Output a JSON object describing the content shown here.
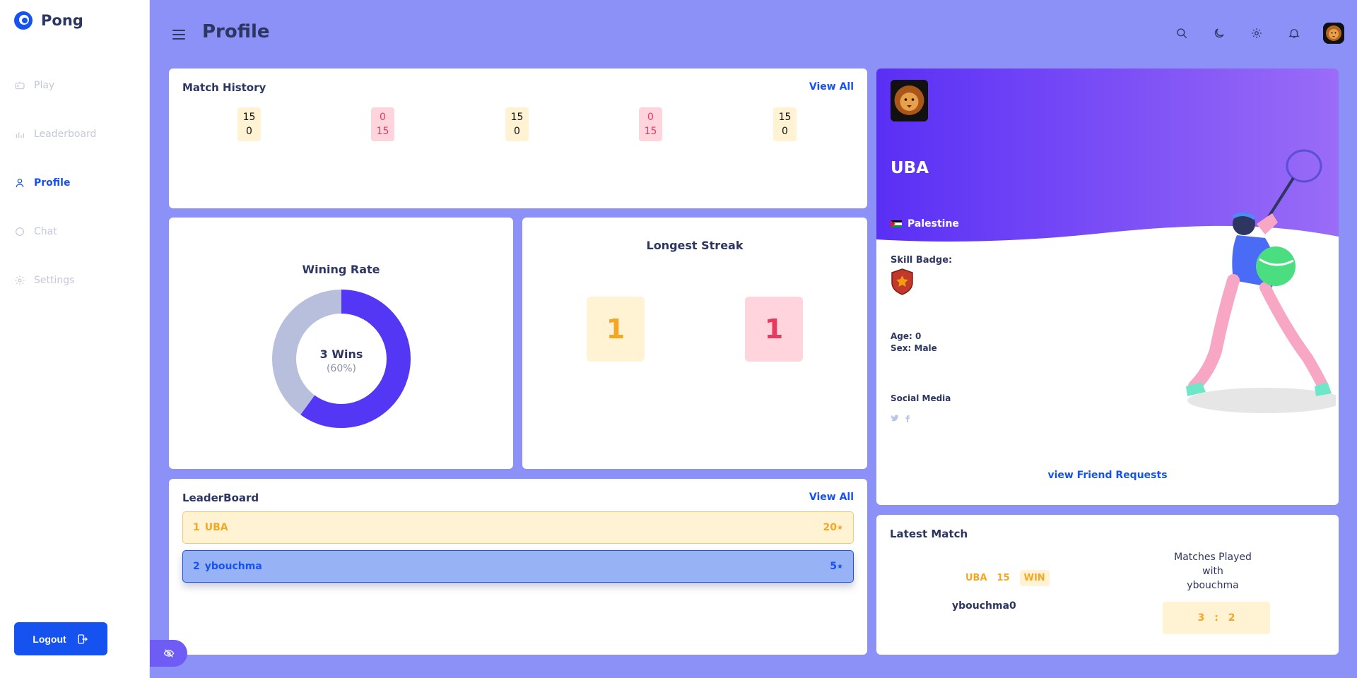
{
  "app": {
    "name": "Pong"
  },
  "sidebar": {
    "items": [
      {
        "label": "Play",
        "icon": "gamepad-icon"
      },
      {
        "label": "Leaderboard",
        "icon": "bar-chart-icon"
      },
      {
        "label": "Profile",
        "icon": "user-icon",
        "active": true
      },
      {
        "label": "Chat",
        "icon": "chat-icon"
      },
      {
        "label": "Settings",
        "icon": "gear-icon"
      }
    ],
    "logout_label": "Logout"
  },
  "header": {
    "title": "Profile"
  },
  "match_history": {
    "title": "Match History",
    "view_all": "View All",
    "matches": [
      {
        "top": "15",
        "bottom": "0",
        "result": "win"
      },
      {
        "top": "0",
        "bottom": "15",
        "result": "loss"
      },
      {
        "top": "15",
        "bottom": "0",
        "result": "win"
      },
      {
        "top": "0",
        "bottom": "15",
        "result": "loss"
      },
      {
        "top": "15",
        "bottom": "0",
        "result": "win"
      }
    ]
  },
  "wining_rate": {
    "title": "Wining Rate",
    "wins_label": "3 Wins",
    "percent_label": "(60%)",
    "win_fraction": 0.6,
    "colors": {
      "win": "#5436f5",
      "loss": "#b8bfdc"
    }
  },
  "longest_streak": {
    "title": "Longest Streak",
    "win_streak": "1",
    "loss_streak": "1"
  },
  "leaderboard": {
    "title": "LeaderBoard",
    "view_all": "View All",
    "rows": [
      {
        "rank": "1",
        "name": "UBA",
        "points": "20"
      },
      {
        "rank": "2",
        "name": "ybouchma",
        "points": "5"
      }
    ]
  },
  "profile": {
    "name": "UBA",
    "country": "Palestine",
    "skill_badge_label": "Skill Badge:",
    "age": "Age: 0",
    "sex": "Sex: Male",
    "social_label": "Social Media",
    "friend_requests": "view Friend Requests"
  },
  "latest_match": {
    "title": "Latest Match",
    "player": "UBA",
    "score": "15",
    "result": "WIN",
    "opponent": "ybouchma0",
    "matches_played_line1": "Matches Played",
    "matches_played_line2": "with",
    "matches_played_line3": "ybouchma",
    "wins": "3",
    "separator": ":",
    "losses": "2"
  },
  "colors": {
    "accent": "#1652f0",
    "background": "#8b91f6",
    "win": "#f5a623",
    "loss": "#e83a5e"
  }
}
